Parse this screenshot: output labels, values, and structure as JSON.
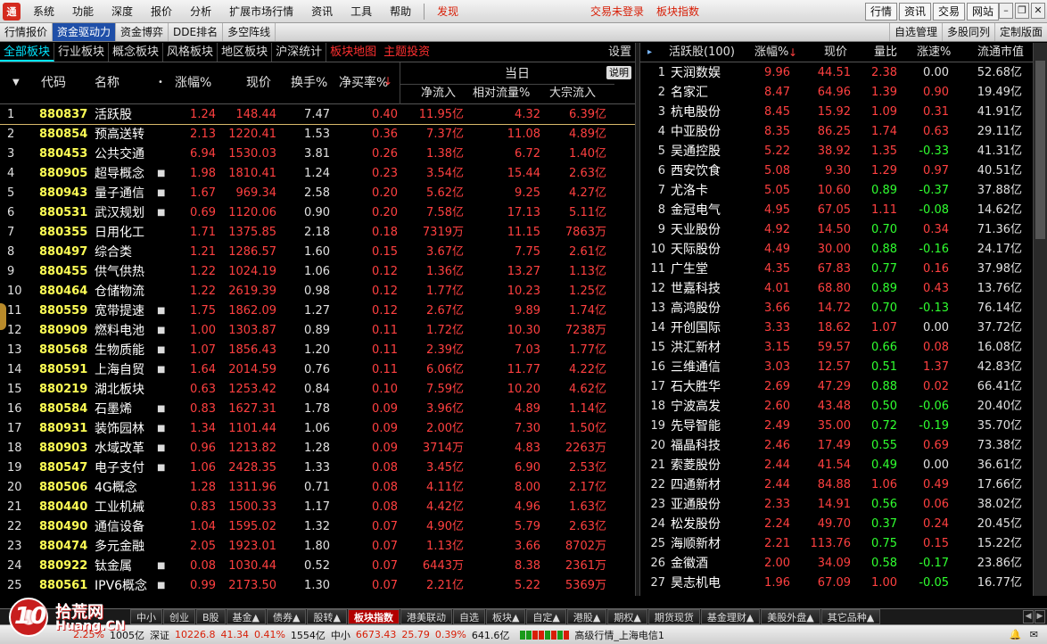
{
  "menubar": {
    "items": [
      "系统",
      "功能",
      "深度",
      "报价",
      "分析",
      "扩展市场行情",
      "资讯",
      "工具",
      "帮助"
    ],
    "highlight": "发现",
    "login_status": "交易未登录",
    "index_title": "板块指数",
    "right_buttons": [
      "行情",
      "资讯",
      "交易",
      "网站"
    ],
    "logo_text": "通"
  },
  "toolbar": {
    "tabs": [
      "行情报价",
      "资金驱动力",
      "资金博弈",
      "DDE排名",
      "多空阵线"
    ],
    "active_index": 1,
    "right": [
      "自选管理",
      "多股同列",
      "定制版面"
    ]
  },
  "category_tabs": {
    "items": [
      "全部板块",
      "行业板块",
      "概念板块",
      "风格板块",
      "地区板块",
      "沪深统计"
    ],
    "red_items": [
      "板块地图",
      "主题投资"
    ],
    "active_index": 0,
    "settings": "设置"
  },
  "left_table": {
    "headers": {
      "code": "代码",
      "name": "名称",
      "pct": "涨幅%",
      "price": "现价",
      "turnover": "换手%",
      "net_buy": "净买率%",
      "group": "当日",
      "explain": "说明",
      "inflow": "净流入",
      "relative": "相对流量%",
      "block": "大宗流入"
    },
    "rows": [
      {
        "idx": "1",
        "code": "880837",
        "name": "活跃股",
        "dot": "",
        "pct": "1.24",
        "price": "148.44",
        "turnover": "7.47",
        "net": "0.40",
        "inflow": "11.95亿",
        "rel": "4.32",
        "block": "6.39亿"
      },
      {
        "idx": "2",
        "code": "880854",
        "name": "预高送转",
        "dot": "",
        "pct": "2.13",
        "price": "1220.41",
        "turnover": "1.53",
        "net": "0.36",
        "inflow": "7.37亿",
        "rel": "11.08",
        "block": "4.89亿"
      },
      {
        "idx": "3",
        "code": "880453",
        "name": "公共交通",
        "dot": "",
        "pct": "6.94",
        "price": "1530.03",
        "turnover": "3.81",
        "net": "0.26",
        "inflow": "1.38亿",
        "rel": "6.72",
        "block": "1.40亿"
      },
      {
        "idx": "4",
        "code": "880905",
        "name": "超导概念",
        "dot": "■",
        "pct": "1.98",
        "price": "1810.41",
        "turnover": "1.24",
        "net": "0.23",
        "inflow": "3.54亿",
        "rel": "15.44",
        "block": "2.63亿"
      },
      {
        "idx": "5",
        "code": "880943",
        "name": "量子通信",
        "dot": "■",
        "pct": "1.67",
        "price": "969.34",
        "turnover": "2.58",
        "net": "0.20",
        "inflow": "5.62亿",
        "rel": "9.25",
        "block": "4.27亿"
      },
      {
        "idx": "6",
        "code": "880531",
        "name": "武汉规划",
        "dot": "■",
        "pct": "0.69",
        "price": "1120.06",
        "turnover": "0.90",
        "net": "0.20",
        "inflow": "7.58亿",
        "rel": "17.13",
        "block": "5.11亿"
      },
      {
        "idx": "7",
        "code": "880355",
        "name": "日用化工",
        "dot": "",
        "pct": "1.71",
        "price": "1375.85",
        "turnover": "2.18",
        "net": "0.18",
        "inflow": "7319万",
        "rel": "11.15",
        "block": "7863万"
      },
      {
        "idx": "8",
        "code": "880497",
        "name": "综合类",
        "dot": "",
        "pct": "1.21",
        "price": "1286.57",
        "turnover": "1.60",
        "net": "0.15",
        "inflow": "3.67亿",
        "rel": "7.75",
        "block": "2.61亿"
      },
      {
        "idx": "9",
        "code": "880455",
        "name": "供气供热",
        "dot": "",
        "pct": "1.22",
        "price": "1024.19",
        "turnover": "1.06",
        "net": "0.12",
        "inflow": "1.36亿",
        "rel": "13.27",
        "block": "1.13亿"
      },
      {
        "idx": "10",
        "code": "880464",
        "name": "仓储物流",
        "dot": "",
        "pct": "1.22",
        "price": "2619.39",
        "turnover": "0.98",
        "net": "0.12",
        "inflow": "1.77亿",
        "rel": "10.23",
        "block": "1.25亿"
      },
      {
        "idx": "11",
        "code": "880559",
        "name": "宽带提速",
        "dot": "■",
        "pct": "1.75",
        "price": "1862.09",
        "turnover": "1.27",
        "net": "0.12",
        "inflow": "2.67亿",
        "rel": "9.89",
        "block": "1.74亿"
      },
      {
        "idx": "12",
        "code": "880909",
        "name": "燃料电池",
        "dot": "■",
        "pct": "1.00",
        "price": "1303.87",
        "turnover": "0.89",
        "net": "0.11",
        "inflow": "1.72亿",
        "rel": "10.30",
        "block": "7238万"
      },
      {
        "idx": "13",
        "code": "880568",
        "name": "生物质能",
        "dot": "■",
        "pct": "1.07",
        "price": "1856.43",
        "turnover": "1.20",
        "net": "0.11",
        "inflow": "2.39亿",
        "rel": "7.03",
        "block": "1.77亿"
      },
      {
        "idx": "14",
        "code": "880591",
        "name": "上海自贸",
        "dot": "■",
        "pct": "1.64",
        "price": "2014.59",
        "turnover": "0.76",
        "net": "0.11",
        "inflow": "6.06亿",
        "rel": "11.77",
        "block": "4.22亿"
      },
      {
        "idx": "15",
        "code": "880219",
        "name": "湖北板块",
        "dot": "",
        "pct": "0.63",
        "price": "1253.42",
        "turnover": "0.84",
        "net": "0.10",
        "inflow": "7.59亿",
        "rel": "10.20",
        "block": "4.62亿"
      },
      {
        "idx": "16",
        "code": "880584",
        "name": "石墨烯",
        "dot": "■",
        "pct": "0.83",
        "price": "1627.31",
        "turnover": "1.78",
        "net": "0.09",
        "inflow": "3.96亿",
        "rel": "4.89",
        "block": "1.14亿"
      },
      {
        "idx": "17",
        "code": "880931",
        "name": "装饰园林",
        "dot": "■",
        "pct": "1.34",
        "price": "1101.44",
        "turnover": "1.06",
        "net": "0.09",
        "inflow": "2.00亿",
        "rel": "7.30",
        "block": "1.50亿"
      },
      {
        "idx": "18",
        "code": "880903",
        "name": "水域改革",
        "dot": "■",
        "pct": "0.96",
        "price": "1213.82",
        "turnover": "1.28",
        "net": "0.09",
        "inflow": "3714万",
        "rel": "4.83",
        "block": "2263万"
      },
      {
        "idx": "19",
        "code": "880547",
        "name": "电子支付",
        "dot": "■",
        "pct": "1.06",
        "price": "2428.35",
        "turnover": "1.33",
        "net": "0.08",
        "inflow": "3.45亿",
        "rel": "6.90",
        "block": "2.53亿"
      },
      {
        "idx": "20",
        "code": "880506",
        "name": "4G概念",
        "dot": "",
        "pct": "1.28",
        "price": "1311.96",
        "turnover": "0.71",
        "net": "0.08",
        "inflow": "4.11亿",
        "rel": "8.00",
        "block": "2.17亿"
      },
      {
        "idx": "21",
        "code": "880440",
        "name": "工业机械",
        "dot": "",
        "pct": "0.83",
        "price": "1500.33",
        "turnover": "1.17",
        "net": "0.08",
        "inflow": "4.42亿",
        "rel": "4.96",
        "block": "1.63亿"
      },
      {
        "idx": "22",
        "code": "880490",
        "name": "通信设备",
        "dot": "",
        "pct": "1.04",
        "price": "1595.02",
        "turnover": "1.32",
        "net": "0.07",
        "inflow": "4.90亿",
        "rel": "5.79",
        "block": "2.63亿"
      },
      {
        "idx": "23",
        "code": "880474",
        "name": "多元金融",
        "dot": "",
        "pct": "2.05",
        "price": "1923.01",
        "turnover": "1.80",
        "net": "0.07",
        "inflow": "1.13亿",
        "rel": "3.66",
        "block": "8702万"
      },
      {
        "idx": "24",
        "code": "880922",
        "name": "钛金属",
        "dot": "■",
        "pct": "0.08",
        "price": "1030.44",
        "turnover": "0.52",
        "net": "0.07",
        "inflow": "6443万",
        "rel": "8.38",
        "block": "2361万"
      },
      {
        "idx": "25",
        "code": "880561",
        "name": "IPV6概念",
        "dot": "■",
        "pct": "0.99",
        "price": "2173.50",
        "turnover": "1.30",
        "net": "0.07",
        "inflow": "2.21亿",
        "rel": "5.22",
        "block": "5369万"
      }
    ]
  },
  "right_table": {
    "headers": {
      "name": "活跃股(100)",
      "pct": "涨幅%",
      "price": "现价",
      "vol_ratio": "量比",
      "speed": "涨速%",
      "cap": "流通市值"
    },
    "colors": {
      "up": "#ff4040",
      "down": "#30ff30",
      "flat": "#e0e0e0"
    },
    "rows": [
      {
        "idx": "1",
        "name": "天润数娱",
        "pct": "9.96",
        "price": "44.51",
        "vol": "2.38",
        "vol_dir": "up",
        "speed": "0.00",
        "speed_dir": "flat",
        "cap": "52.68亿"
      },
      {
        "idx": "2",
        "name": "名家汇",
        "pct": "8.47",
        "price": "64.96",
        "vol": "1.39",
        "vol_dir": "up",
        "speed": "0.90",
        "speed_dir": "up",
        "cap": "19.49亿"
      },
      {
        "idx": "3",
        "name": "杭电股份",
        "pct": "8.45",
        "price": "15.92",
        "vol": "1.09",
        "vol_dir": "up",
        "speed": "0.31",
        "speed_dir": "up",
        "cap": "41.91亿"
      },
      {
        "idx": "4",
        "name": "中亚股份",
        "pct": "8.35",
        "price": "86.25",
        "vol": "1.74",
        "vol_dir": "up",
        "speed": "0.63",
        "speed_dir": "up",
        "cap": "29.11亿"
      },
      {
        "idx": "5",
        "name": "吴通控股",
        "pct": "5.22",
        "price": "38.92",
        "vol": "1.35",
        "vol_dir": "up",
        "speed": "-0.33",
        "speed_dir": "down",
        "cap": "41.31亿"
      },
      {
        "idx": "6",
        "name": "西安饮食",
        "pct": "5.08",
        "price": "9.30",
        "vol": "1.29",
        "vol_dir": "up",
        "speed": "0.97",
        "speed_dir": "up",
        "cap": "40.51亿"
      },
      {
        "idx": "7",
        "name": "尤洛卡",
        "pct": "5.05",
        "price": "10.60",
        "vol": "0.89",
        "vol_dir": "down",
        "speed": "-0.37",
        "speed_dir": "down",
        "cap": "37.88亿"
      },
      {
        "idx": "8",
        "name": "金冠电气",
        "pct": "4.95",
        "price": "67.05",
        "vol": "1.11",
        "vol_dir": "up",
        "speed": "-0.08",
        "speed_dir": "down",
        "cap": "14.62亿"
      },
      {
        "idx": "9",
        "name": "天业股份",
        "pct": "4.92",
        "price": "14.50",
        "vol": "0.70",
        "vol_dir": "down",
        "speed": "0.34",
        "speed_dir": "up",
        "cap": "71.36亿"
      },
      {
        "idx": "10",
        "name": "天际股份",
        "pct": "4.49",
        "price": "30.00",
        "vol": "0.88",
        "vol_dir": "down",
        "speed": "-0.16",
        "speed_dir": "down",
        "cap": "24.17亿"
      },
      {
        "idx": "11",
        "name": "广生堂",
        "pct": "4.35",
        "price": "67.83",
        "vol": "0.77",
        "vol_dir": "down",
        "speed": "0.16",
        "speed_dir": "up",
        "cap": "37.98亿"
      },
      {
        "idx": "12",
        "name": "世嘉科技",
        "pct": "4.01",
        "price": "68.80",
        "vol": "0.89",
        "vol_dir": "down",
        "speed": "0.43",
        "speed_dir": "up",
        "cap": "13.76亿"
      },
      {
        "idx": "13",
        "name": "高鸿股份",
        "pct": "3.66",
        "price": "14.72",
        "vol": "0.70",
        "vol_dir": "down",
        "speed": "-0.13",
        "speed_dir": "down",
        "cap": "76.14亿"
      },
      {
        "idx": "14",
        "name": "开创国际",
        "pct": "3.33",
        "price": "18.62",
        "vol": "1.07",
        "vol_dir": "up",
        "speed": "0.00",
        "speed_dir": "flat",
        "cap": "37.72亿"
      },
      {
        "idx": "15",
        "name": "洪汇新材",
        "pct": "3.15",
        "price": "59.57",
        "vol": "0.66",
        "vol_dir": "down",
        "speed": "0.08",
        "speed_dir": "up",
        "cap": "16.08亿"
      },
      {
        "idx": "16",
        "name": "三维通信",
        "pct": "3.03",
        "price": "12.57",
        "vol": "0.51",
        "vol_dir": "down",
        "speed": "1.37",
        "speed_dir": "up",
        "cap": "42.83亿"
      },
      {
        "idx": "17",
        "name": "石大胜华",
        "pct": "2.69",
        "price": "47.29",
        "vol": "0.88",
        "vol_dir": "down",
        "speed": "0.02",
        "speed_dir": "up",
        "cap": "66.41亿"
      },
      {
        "idx": "18",
        "name": "宁波高发",
        "pct": "2.60",
        "price": "43.48",
        "vol": "0.50",
        "vol_dir": "down",
        "speed": "-0.06",
        "speed_dir": "down",
        "cap": "20.40亿"
      },
      {
        "idx": "19",
        "name": "先导智能",
        "pct": "2.49",
        "price": "35.00",
        "vol": "0.72",
        "vol_dir": "down",
        "speed": "-0.19",
        "speed_dir": "down",
        "cap": "35.70亿"
      },
      {
        "idx": "20",
        "name": "福晶科技",
        "pct": "2.46",
        "price": "17.49",
        "vol": "0.55",
        "vol_dir": "down",
        "speed": "0.69",
        "speed_dir": "up",
        "cap": "73.38亿"
      },
      {
        "idx": "21",
        "name": "索菱股份",
        "pct": "2.44",
        "price": "41.54",
        "vol": "0.49",
        "vol_dir": "down",
        "speed": "0.00",
        "speed_dir": "flat",
        "cap": "36.61亿"
      },
      {
        "idx": "22",
        "name": "四通新材",
        "pct": "2.44",
        "price": "84.88",
        "vol": "1.06",
        "vol_dir": "up",
        "speed": "0.49",
        "speed_dir": "up",
        "cap": "17.66亿"
      },
      {
        "idx": "23",
        "name": "亚通股份",
        "pct": "2.33",
        "price": "14.91",
        "vol": "0.56",
        "vol_dir": "down",
        "speed": "0.06",
        "speed_dir": "up",
        "cap": "38.02亿"
      },
      {
        "idx": "24",
        "name": "松发股份",
        "pct": "2.24",
        "price": "49.70",
        "vol": "0.37",
        "vol_dir": "down",
        "speed": "0.24",
        "speed_dir": "up",
        "cap": "20.45亿"
      },
      {
        "idx": "25",
        "name": "海顺新材",
        "pct": "2.21",
        "price": "113.76",
        "vol": "0.75",
        "vol_dir": "down",
        "speed": "0.15",
        "speed_dir": "up",
        "cap": "15.22亿"
      },
      {
        "idx": "26",
        "name": "金徽酒",
        "pct": "2.00",
        "price": "34.09",
        "vol": "0.58",
        "vol_dir": "down",
        "speed": "-0.17",
        "speed_dir": "down",
        "cap": "23.86亿"
      },
      {
        "idx": "27",
        "name": "昊志机电",
        "pct": "1.96",
        "price": "67.09",
        "vol": "1.00",
        "vol_dir": "up",
        "speed": "-0.05",
        "speed_dir": "down",
        "cap": "16.77亿"
      }
    ]
  },
  "bottom_tabs": {
    "items": [
      "中小",
      "创业",
      "B股",
      "基金▲",
      "债券▲",
      "股转▲",
      "板块指数",
      "港美联动",
      "自选",
      "板块▲",
      "自定▲",
      "港股▲",
      "期权▲",
      "期货现货",
      "基金理财▲",
      "美股外盘▲",
      "其它品种▲"
    ],
    "active_index": 6
  },
  "statusbar": {
    "items": [
      "1005亿",
      "深证",
      "10226.8",
      "41.34",
      "0.41%",
      "1554亿",
      "中小",
      "6673.43",
      "25.79",
      "0.39%",
      "641.6亿",
      "高级行情_上海电信1"
    ],
    "partial_left": "2.25%"
  },
  "watermark": {
    "num": "10",
    "cn": "拾荒网",
    "en": "Huang.CN"
  }
}
